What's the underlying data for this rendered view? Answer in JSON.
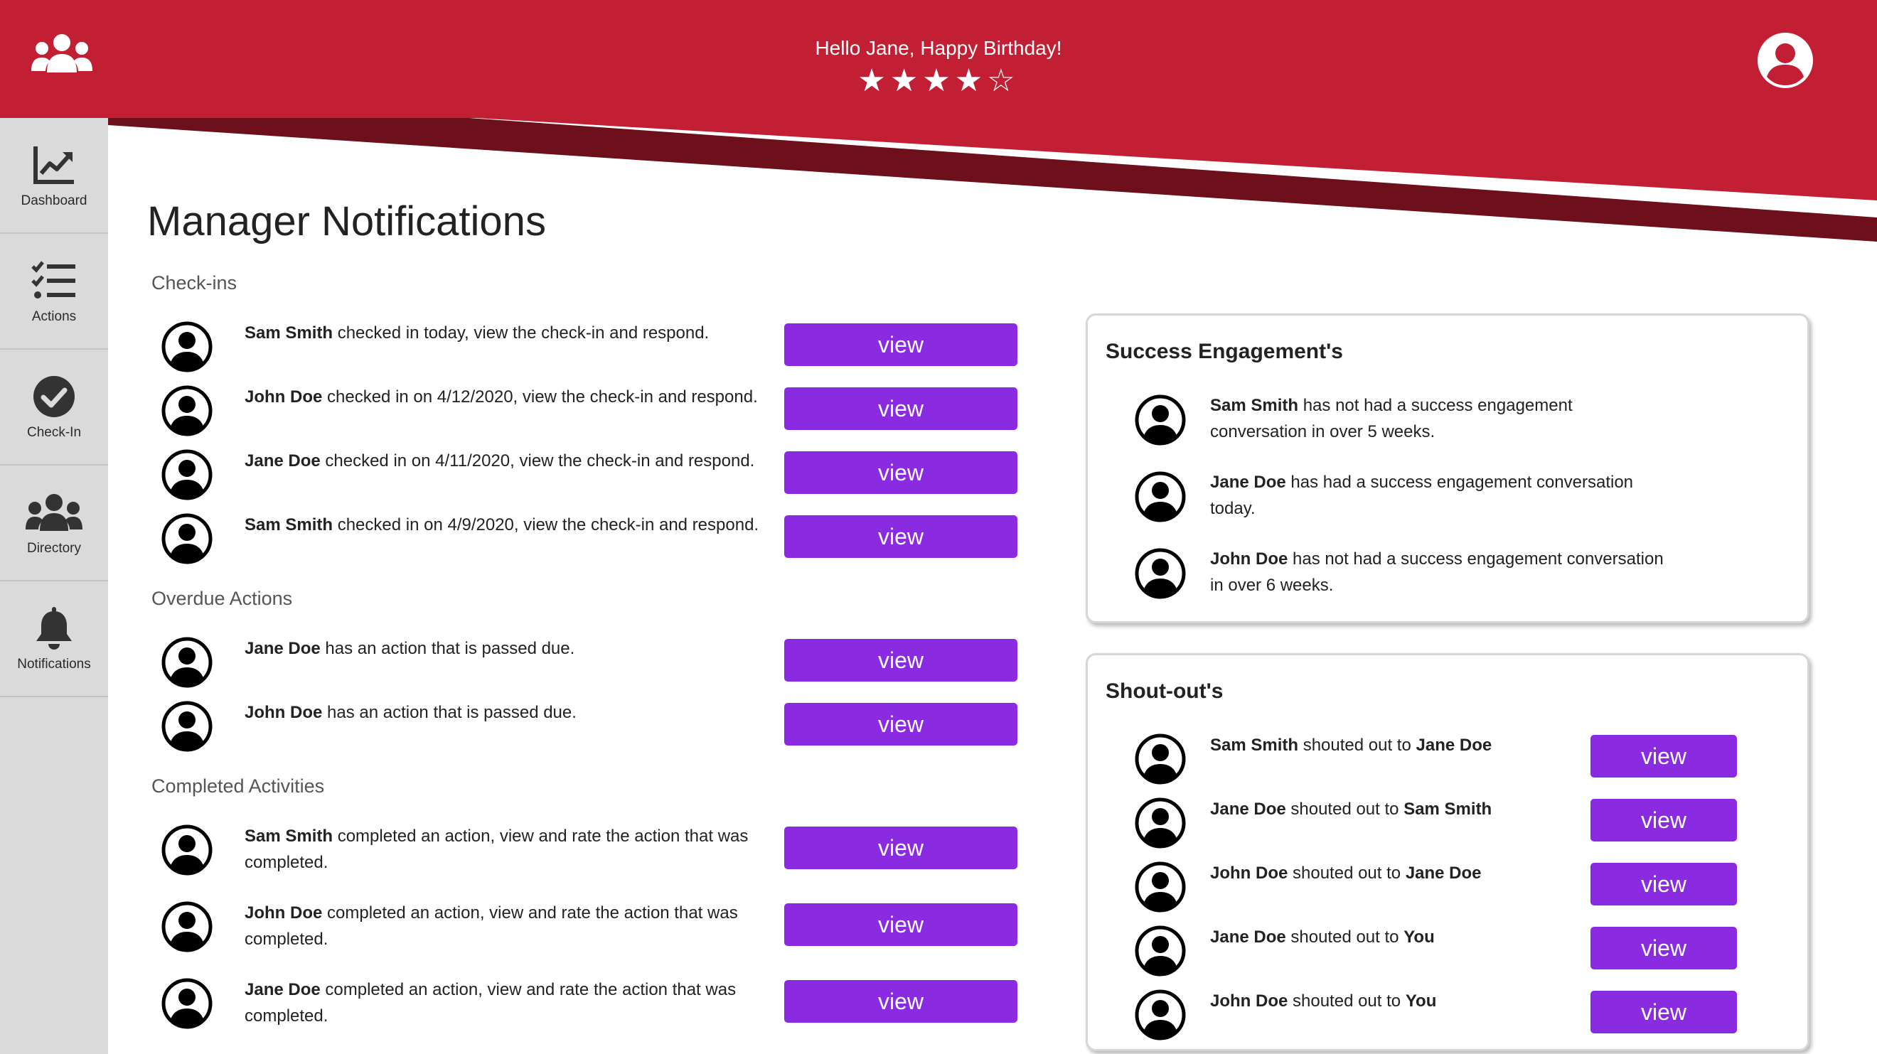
{
  "header": {
    "greeting": "Hello Jane, Happy Birthday!",
    "rating": {
      "value": 4,
      "max": 5,
      "display": "★★★★☆"
    },
    "colors": {
      "brand": "#c21f35",
      "brand_dark": "#6e0f1c"
    },
    "logo_icon": "team-icon",
    "profile_icon": "user-circle-icon"
  },
  "sidebar": {
    "items": [
      {
        "label": "Dashboard",
        "icon": "chart-line-icon"
      },
      {
        "label": "Actions",
        "icon": "checklist-icon"
      },
      {
        "label": "Check-In",
        "icon": "check-circle-icon"
      },
      {
        "label": "Directory",
        "icon": "users-icon"
      },
      {
        "label": "Notifications",
        "icon": "bell-icon"
      }
    ]
  },
  "page": {
    "title": "Manager Notifications"
  },
  "accent_color": "#8a2be2",
  "checkins": {
    "title": "Check-ins",
    "items": [
      {
        "name": "Sam Smith",
        "text": " checked in today, view the check-in and respond.",
        "button": "view"
      },
      {
        "name": "John Doe",
        "text": " checked in on 4/12/2020, view the check-in and respond.",
        "button": "view"
      },
      {
        "name": "Jane Doe",
        "text": " checked in on 4/11/2020, view the check-in and respond.",
        "button": "view"
      },
      {
        "name": "Sam Smith",
        "text": " checked in on 4/9/2020, view the check-in and respond.",
        "button": "view"
      }
    ]
  },
  "overdue": {
    "title": "Overdue Actions",
    "items": [
      {
        "name": "Jane Doe",
        "text": " has an action that is passed due.",
        "button": "view"
      },
      {
        "name": "John Doe",
        "text": " has an action that is passed due.",
        "button": "view"
      }
    ]
  },
  "completed": {
    "title": "Completed Activities",
    "items": [
      {
        "name": "Sam Smith",
        "text": " completed an action, view and rate the action that was completed.",
        "button": "view"
      },
      {
        "name": "John Doe",
        "text": " completed an action, view and rate the action that was completed.",
        "button": "view"
      },
      {
        "name": "Jane Doe",
        "text": " completed an action, view and rate the action that was completed.",
        "button": "view"
      }
    ]
  },
  "success": {
    "title": "Success Engagement's",
    "items": [
      {
        "name": "Sam Smith",
        "text": " has not had a success engagement conversation in over 5 weeks."
      },
      {
        "name": "Jane Doe",
        "text": " has had a success engagement conversation today."
      },
      {
        "name": "John Doe",
        "text": " has not had a success engagement conversation in over 6 weeks."
      }
    ]
  },
  "shoutouts": {
    "title": "Shout-out's",
    "connector": " shouted out to ",
    "items": [
      {
        "from": "Sam Smith",
        "to": "Jane Doe",
        "button": "view"
      },
      {
        "from": "Jane Doe",
        "to": "Sam Smith",
        "button": "view"
      },
      {
        "from": "John Doe",
        "to": "Jane Doe",
        "button": "view"
      },
      {
        "from": "Jane Doe",
        "to": "You",
        "button": "view"
      },
      {
        "from": "John Doe",
        "to": "You",
        "button": "view"
      }
    ]
  }
}
